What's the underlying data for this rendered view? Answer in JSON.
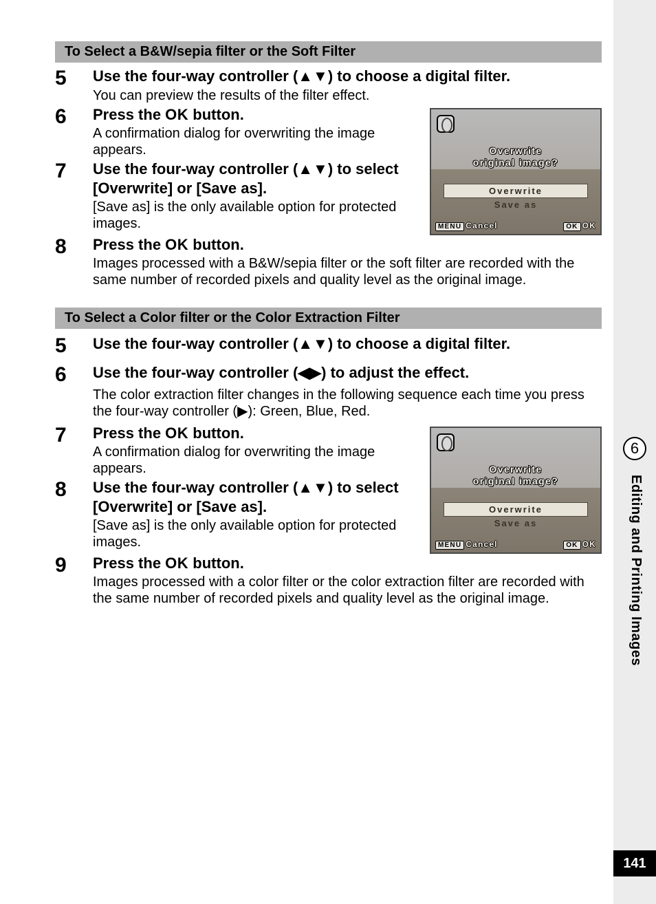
{
  "sideTab": {
    "chapterNumber": "6",
    "chapterTitle": "Editing and Printing Images",
    "pageNumber": "141"
  },
  "ok_glyph": "OK",
  "arrows": {
    "updown": "▲▼",
    "leftright": "◀▶",
    "right": "▶"
  },
  "sectionA": {
    "header": "To Select a B&W/sepia filter or the Soft Filter",
    "steps": {
      "s5": {
        "num": "5",
        "title_a": "Use the four-way controller (",
        "title_b": ") to choose a digital filter.",
        "desc": "You can preview the results of the filter effect."
      },
      "s6": {
        "num": "6",
        "title_a": "Press the ",
        "title_b": " button.",
        "desc": "A confirmation dialog for overwriting the image appears."
      },
      "s7": {
        "num": "7",
        "title_a": "Use the four-way controller (",
        "title_b": ") to select [Overwrite] or [Save as].",
        "desc": "[Save as] is the only available option for protected images."
      },
      "s8": {
        "num": "8",
        "title_a": "Press the ",
        "title_b": " button.",
        "desc": "Images processed with a B&W/sepia filter or the soft filter are recorded with the same number of recorded pixels and quality level as the original image."
      }
    }
  },
  "sectionB": {
    "header": "To Select a Color filter or the Color Extraction Filter",
    "steps": {
      "s5": {
        "num": "5",
        "title_a": "Use the four-way controller (",
        "title_b": ") to choose a digital filter."
      },
      "s6": {
        "num": "6",
        "title_a": "Use the four-way controller (",
        "title_b": ") to adjust the effect.",
        "desc_a": "The color extraction filter changes in the following sequence each time you press the four-way controller (",
        "desc_b": "): Green, Blue, Red."
      },
      "s7": {
        "num": "7",
        "title_a": "Press the ",
        "title_b": " button.",
        "desc": "A confirmation dialog for overwriting the image appears."
      },
      "s8": {
        "num": "8",
        "title_a": "Use the four-way controller (",
        "title_b": ") to select [Overwrite] or [Save as].",
        "desc": "[Save as] is the only available option for protected images."
      },
      "s9": {
        "num": "9",
        "title_a": "Press the ",
        "title_b": " button.",
        "desc": "Images processed with a color filter or the color extraction filter are recorded with the same number of recorded pixels and quality level as the original image."
      }
    }
  },
  "lcd": {
    "prompt_line1": "Overwrite",
    "prompt_line2": "original image?",
    "opt1": "Overwrite",
    "opt2": "Save as",
    "menu_btn": "MENU",
    "cancel": "Cancel",
    "ok_btn": "OK",
    "ok_txt": "OK"
  }
}
